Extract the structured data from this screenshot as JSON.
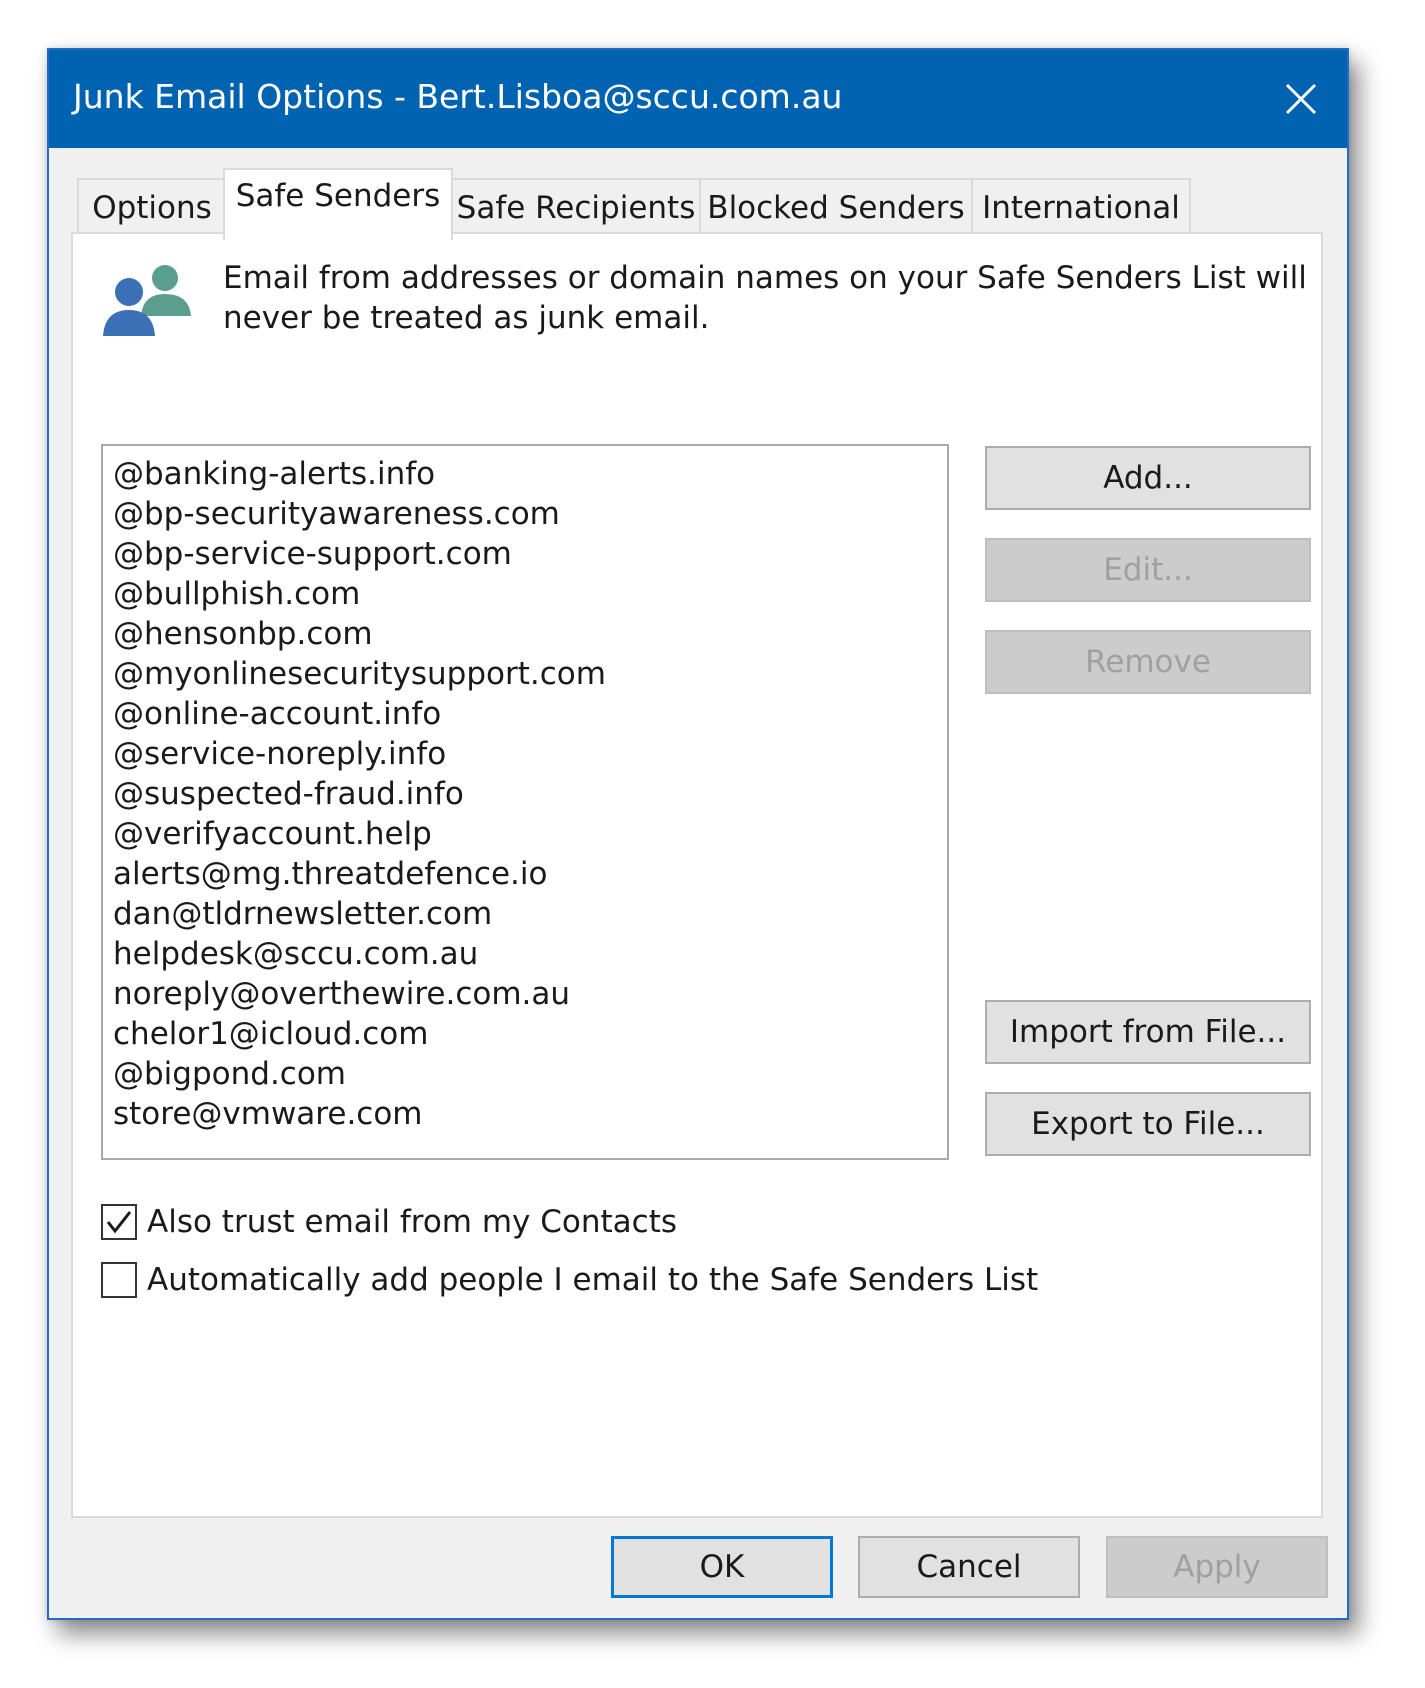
{
  "window": {
    "title": "Junk Email Options - Bert.Lisboa@sccu.com.au"
  },
  "tabs": [
    {
      "label": "Options"
    },
    {
      "label": "Safe Senders"
    },
    {
      "label": "Safe Recipients"
    },
    {
      "label": "Blocked Senders"
    },
    {
      "label": "International"
    }
  ],
  "active_tab": "Safe Senders",
  "panel": {
    "description": "Email from addresses or domain names on your Safe Senders List will never be treated as junk email.",
    "icon": "users-icon"
  },
  "safe_senders": [
    "@banking-alerts.info",
    "@bp-securityawareness.com",
    "@bp-service-support.com",
    "@bullphish.com",
    "@hensonbp.com",
    "@myonlinesecuritysupport.com",
    "@online-account.info",
    "@service-noreply.info",
    "@suspected-fraud.info",
    "@verifyaccount.help",
    "alerts@mg.threatdefence.io",
    "dan@tldrnewsletter.com",
    "helpdesk@sccu.com.au",
    "noreply@overthewire.com.au",
    "chelor1@icloud.com",
    "@bigpond.com",
    "store@vmware.com"
  ],
  "buttons": {
    "add": "Add...",
    "edit": "Edit...",
    "remove": "Remove",
    "import": "Import from File...",
    "export": "Export to File..."
  },
  "options": {
    "trust_contacts": {
      "label": "Also trust email from my Contacts",
      "checked": true
    },
    "auto_add": {
      "label": "Automatically add people I email to the Safe Senders List",
      "checked": false
    }
  },
  "footer": {
    "ok": "OK",
    "cancel": "Cancel",
    "apply": "Apply"
  },
  "colors": {
    "titlebar": "#0063b1",
    "dialog_bg": "#f0f0f0",
    "focus_border": "#0078d7",
    "icon_blue": "#3b6fb6",
    "icon_green": "#5a9e8f"
  }
}
